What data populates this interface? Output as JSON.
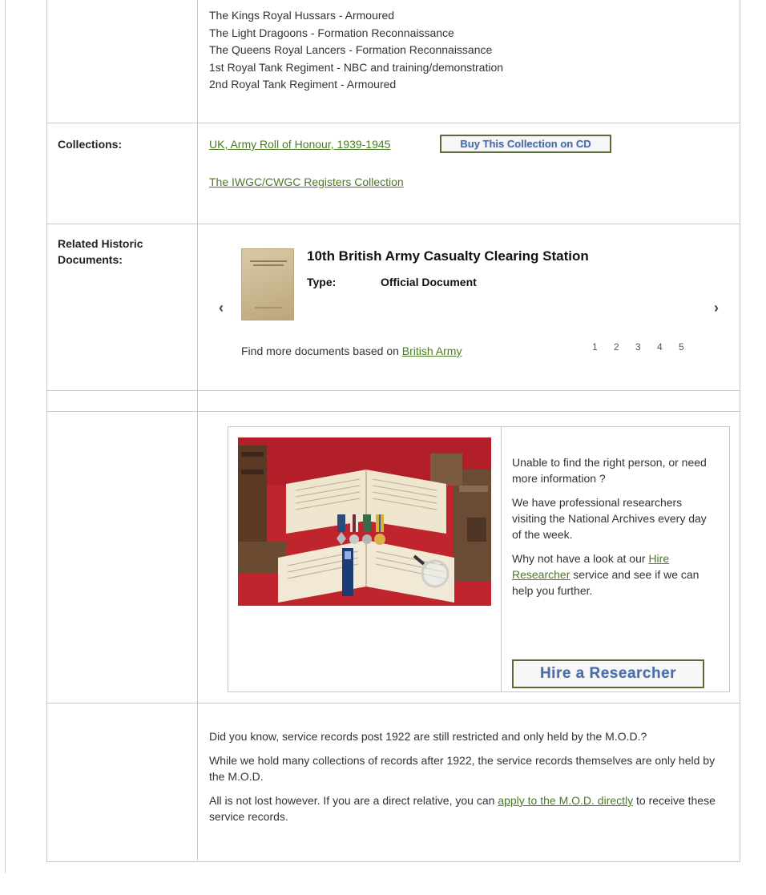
{
  "regiments": [
    "The Kings Royal Hussars - Armoured",
    "The Light Dragoons - Formation Reconnaissance",
    "The Queens Royal Lancers - Formation Reconnaissance",
    "1st Royal Tank Regiment - NBC and training/demonstration",
    "2nd Royal Tank Regiment - Armoured"
  ],
  "collections": {
    "label": "Collections:",
    "link1": "UK, Army Roll of Honour, 1939-1945",
    "buy_button": "Buy This Collection on CD",
    "link2": "The IWGC/CWGC Registers Collection"
  },
  "related": {
    "label_line1": "Related Historic",
    "label_line2": "Documents:",
    "doc_title": "10th British Army Casualty Clearing Station",
    "type_label": "Type:",
    "type_value": "Official Document",
    "prev": "‹",
    "next": "›",
    "more_prefix": "Find more documents based on ",
    "more_link": "British Army",
    "pages": [
      "1",
      "2",
      "3",
      "4",
      "5"
    ]
  },
  "promo": {
    "p1": "Unable to find the right person, or need more information ?",
    "p2": "We have professional researchers visiting the National Archives every day of the week.",
    "p3_prefix": "Why not have a look at our ",
    "p3_link": "Hire Researcher",
    "p3_suffix": " service and see if we can help you further.",
    "button": "Hire a Researcher"
  },
  "mod_info": {
    "p1": "Did you know, service records post 1922 are still restricted and only held by the M.O.D.?",
    "p2": "While we hold many collections of records after 1922, the service records themselves are only held by the M.O.D.",
    "p3_prefix": "All is not lost however. If you are a direct relative, you can ",
    "p3_link": "apply to the M.O.D. directly",
    "p3_suffix": " to receive these service records."
  },
  "colors": {
    "link": "#4a7a22",
    "border": "#c8c8c8",
    "button_text": "#4b6ea8",
    "button_border": "#5b6a3c"
  }
}
